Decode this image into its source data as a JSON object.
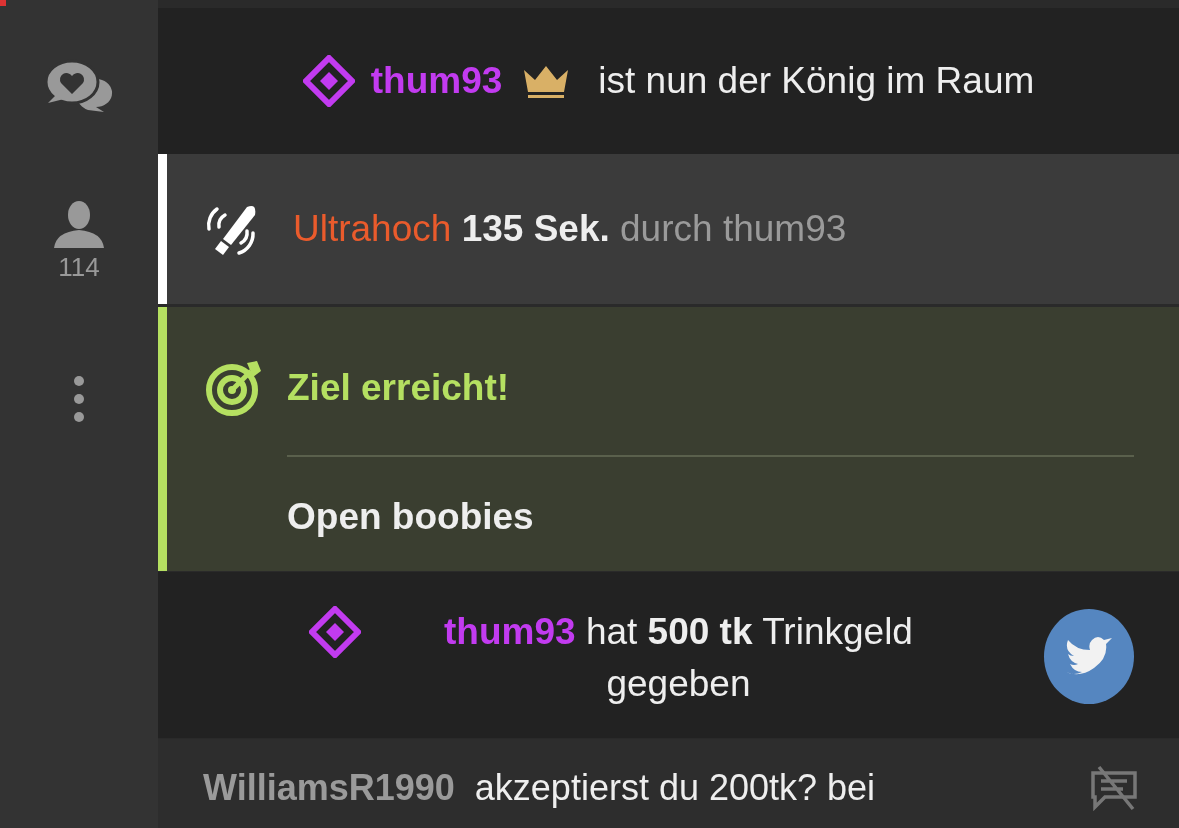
{
  "sidebar": {
    "viewer_count": "114"
  },
  "messages": [
    {
      "kind": "king",
      "user": "thum93",
      "text": "ist nun der König im Raum"
    },
    {
      "kind": "toy",
      "level": "Ultrahoch",
      "duration": "135 Sek.",
      "by": "durch",
      "user": "thum93"
    },
    {
      "kind": "goal",
      "title": "Ziel erreicht!",
      "goal": "Open boobies"
    },
    {
      "kind": "tip",
      "user": "thum93",
      "text": "hat **500 tk** Trinkgeld gegeben"
    },
    {
      "kind": "chat",
      "user": "WilliamsR1990",
      "text": "akzeptierst du 200tk? bei"
    }
  ]
}
